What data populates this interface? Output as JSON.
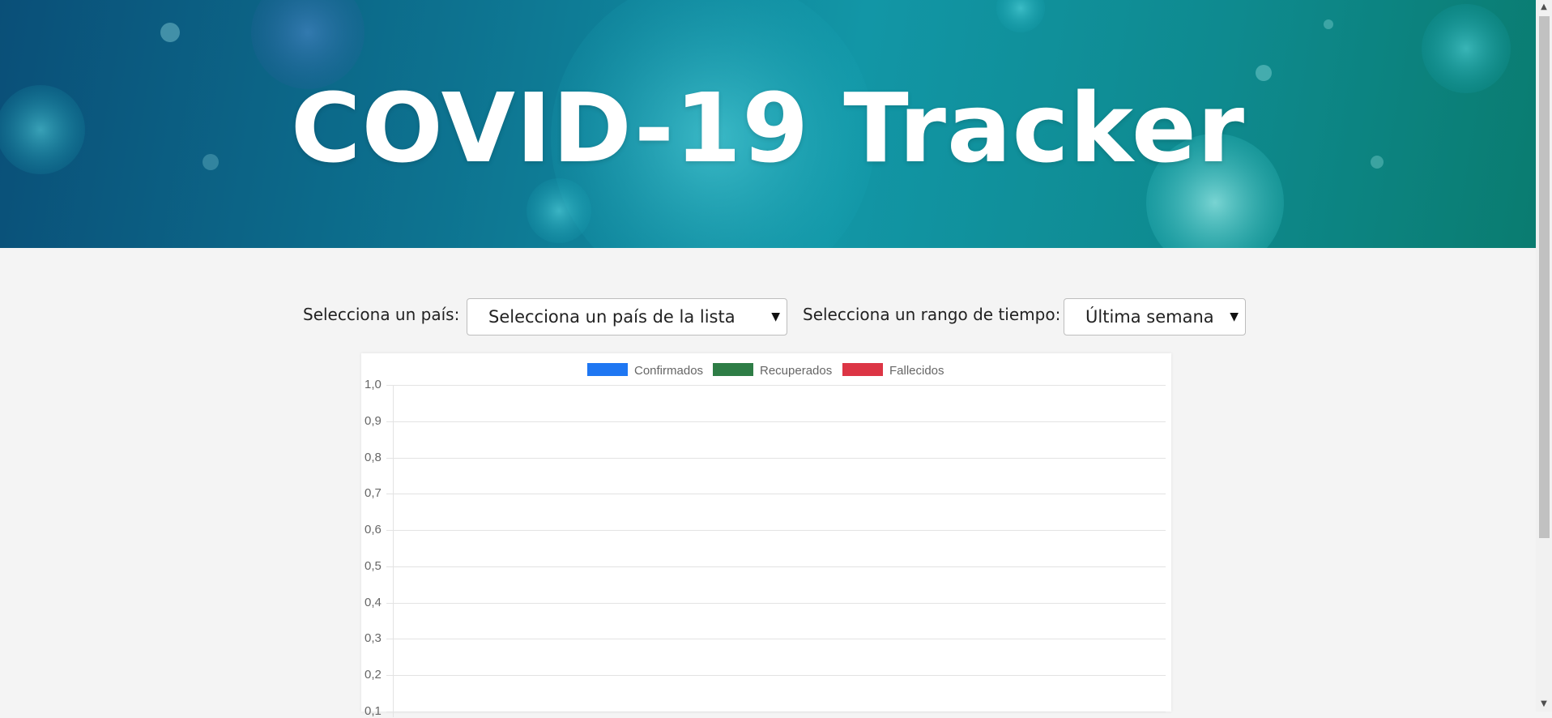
{
  "header": {
    "title": "COVID-19 Tracker"
  },
  "controls": {
    "country_label": "Selecciona un país:",
    "country_value": "Selecciona un país de la lista",
    "range_label": "Selecciona un rango de tiempo:",
    "range_value": "Última semana"
  },
  "chart_data": {
    "type": "line",
    "series": [
      {
        "name": "Confirmados",
        "color": "#1f77f2",
        "values": []
      },
      {
        "name": "Recuperados",
        "color": "#2e7d46",
        "values": []
      },
      {
        "name": "Fallecidos",
        "color": "#dc3545",
        "values": []
      }
    ],
    "y_ticks": [
      "1,0",
      "0,9",
      "0,8",
      "0,7",
      "0,6",
      "0,5",
      "0,4",
      "0,3",
      "0,2",
      "0,1"
    ],
    "ylim": [
      0,
      1
    ],
    "grid": true,
    "legend": "top"
  },
  "colors": {
    "accent": "#0d7390",
    "background": "#f4f4f4"
  },
  "icons": {
    "select_arrow": "chevron-down-icon",
    "scroll_up": "scroll-up-arrow-icon",
    "scroll_down": "scroll-down-arrow-icon"
  }
}
